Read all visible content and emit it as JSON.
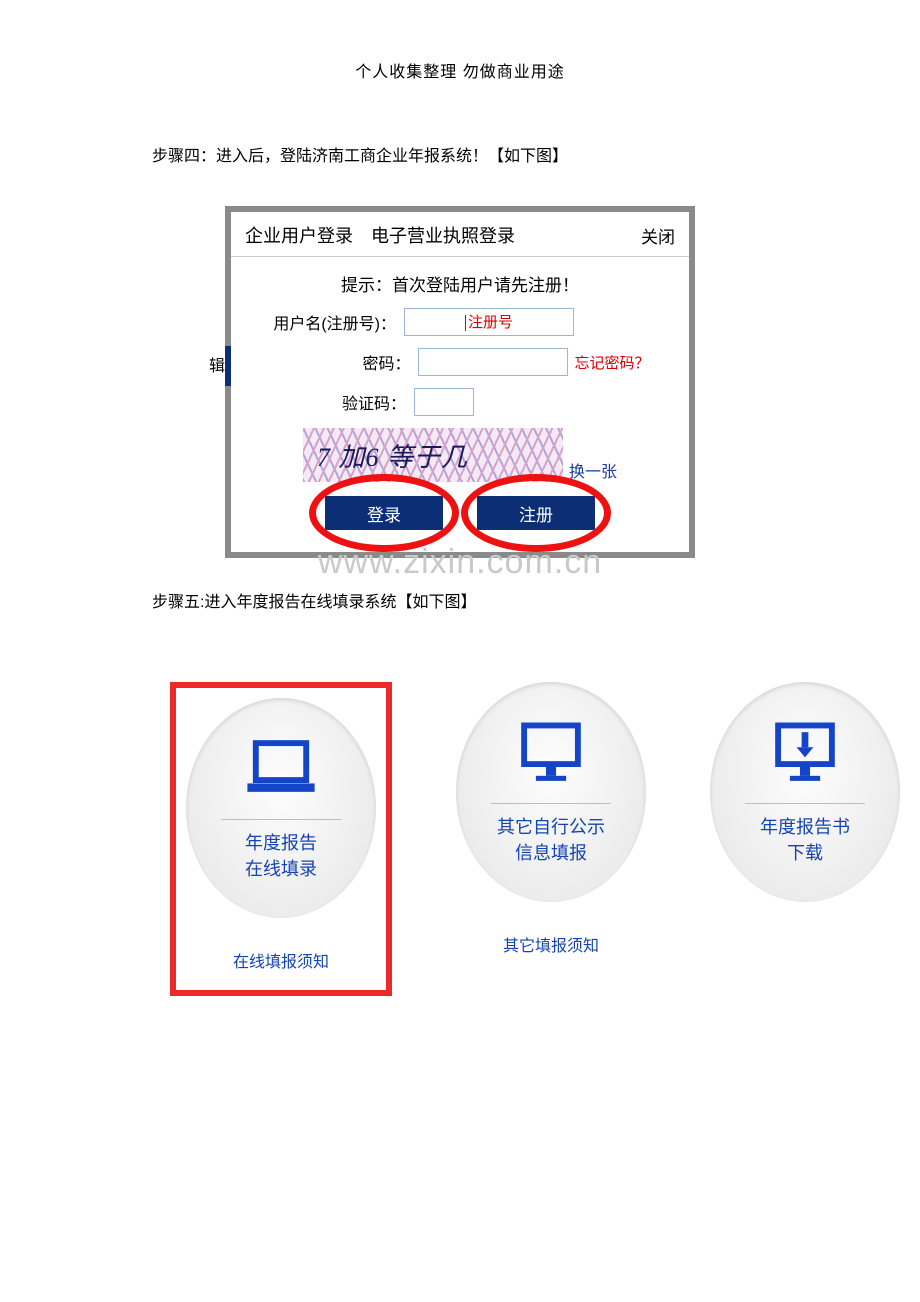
{
  "header": "个人收集整理  勿做商业用途",
  "step4": "步骤四：进入后，登陆济南工商企业年报系统！【如下图】",
  "step5": "步骤五:进入年度报告在线填录系统【如下图】",
  "login": {
    "tab1": "企业用户登录",
    "tab2": "电子营业执照登录",
    "close": "关闭",
    "hint": "提示：首次登陆用户请先注册！",
    "user_label": "用户名(注册号)：",
    "user_placeholder": "注册号",
    "pass_label": "密码：",
    "forgot": "忘记密码？",
    "code_label": "验证码：",
    "captcha_text": "7 加6 等于几",
    "captcha_refresh": "换一张",
    "btn_login": "登录",
    "btn_register": "注册",
    "edge_char": "辑"
  },
  "watermark": "www.zixin.com.cn",
  "cards": [
    {
      "title_l1": "年度报告",
      "title_l2": "在线填录",
      "link": "在线填报须知"
    },
    {
      "title_l1": "其它自行公示",
      "title_l2": "信息填报",
      "link": "其它填报须知"
    },
    {
      "title_l1": "年度报告书",
      "title_l2": "下载",
      "link": ""
    }
  ]
}
